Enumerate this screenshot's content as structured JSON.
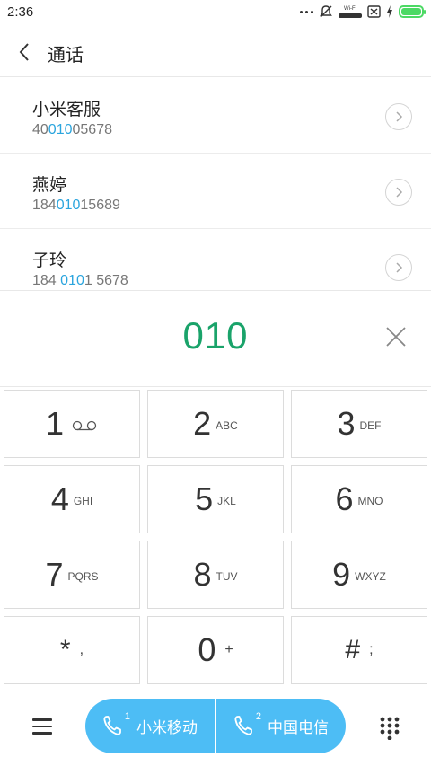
{
  "status_bar": {
    "time": "2:36",
    "wifi_label": "Wi-Fi"
  },
  "header": {
    "title": "通话"
  },
  "contacts": [
    {
      "name": "小米客服",
      "number_pre": "40",
      "number_match": "010",
      "number_post": "05678"
    },
    {
      "name": "燕婷",
      "number_pre": "184",
      "number_match": "010",
      "number_post": "15689"
    },
    {
      "name": "子玲",
      "number_pre": "184 ",
      "number_match": "010",
      "number_post": "1 5678"
    }
  ],
  "input": {
    "typed": "010"
  },
  "keypad": [
    {
      "digit": "1",
      "letters": ""
    },
    {
      "digit": "2",
      "letters": "ABC"
    },
    {
      "digit": "3",
      "letters": "DEF"
    },
    {
      "digit": "4",
      "letters": "GHI"
    },
    {
      "digit": "5",
      "letters": "JKL"
    },
    {
      "digit": "6",
      "letters": "MNO"
    },
    {
      "digit": "7",
      "letters": "PQRS"
    },
    {
      "digit": "8",
      "letters": "TUV"
    },
    {
      "digit": "9",
      "letters": "WXYZ"
    },
    {
      "digit": "*",
      "letters": ","
    },
    {
      "digit": "0",
      "letters": "+"
    },
    {
      "digit": "#",
      "letters": ";"
    }
  ],
  "call_buttons": [
    {
      "sim": "1",
      "carrier": "小米移动"
    },
    {
      "sim": "2",
      "carrier": "中国电信"
    }
  ],
  "colors": {
    "accent": "#4dbdf5",
    "typed_number": "#1aa36a",
    "match_highlight": "#2ba5de",
    "battery": "#4cd964"
  },
  "icons": {
    "back": "back-arrow-icon",
    "clear": "close-icon",
    "voicemail": "voicemail-icon",
    "menu": "menu-icon",
    "dialpad": "dialpad-icon",
    "phone": "phone-icon"
  }
}
